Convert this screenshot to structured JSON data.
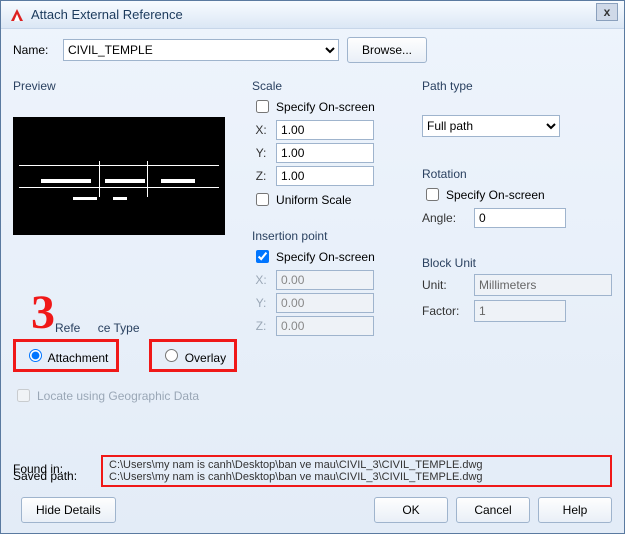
{
  "window": {
    "title": "Attach External Reference",
    "close": "x"
  },
  "name": {
    "label": "Name:",
    "value": "CIVIL_TEMPLE",
    "browse": "Browse..."
  },
  "preview": {
    "label": "Preview"
  },
  "scale": {
    "label": "Scale",
    "specify_label": "Specify On-screen",
    "x_label": "X:",
    "x": "1.00",
    "y_label": "Y:",
    "y": "1.00",
    "z_label": "Z:",
    "z": "1.00",
    "uniform_label": "Uniform Scale"
  },
  "insertion": {
    "label": "Insertion point",
    "specify_label": "Specify On-screen",
    "x_label": "X:",
    "x": "0.00",
    "y_label": "Y:",
    "y": "0.00",
    "z_label": "Z:",
    "z": "0.00"
  },
  "pathtype": {
    "label": "Path type",
    "value": "Full path"
  },
  "rotation": {
    "label": "Rotation",
    "specify_label": "Specify On-screen",
    "angle_label": "Angle:",
    "angle": "0"
  },
  "blockunit": {
    "label": "Block Unit",
    "unit_label": "Unit:",
    "unit": "Millimeters",
    "factor_label": "Factor:",
    "factor": "1"
  },
  "annot": {
    "three": "3"
  },
  "ref": {
    "label": "Reference Type",
    "attachment": "Attachment",
    "overlay": "Overlay"
  },
  "geo": {
    "label": "Locate using Geographic Data"
  },
  "paths": {
    "found_label": "Found in:",
    "saved_label": "Saved path:",
    "found": "C:\\Users\\my nam is canh\\Desktop\\ban ve mau\\CIVIL_3\\CIVIL_TEMPLE.dwg",
    "saved": "C:\\Users\\my nam is canh\\Desktop\\ban ve mau\\CIVIL_3\\CIVIL_TEMPLE.dwg"
  },
  "buttons": {
    "hide": "Hide Details",
    "ok": "OK",
    "cancel": "Cancel",
    "help": "Help"
  }
}
